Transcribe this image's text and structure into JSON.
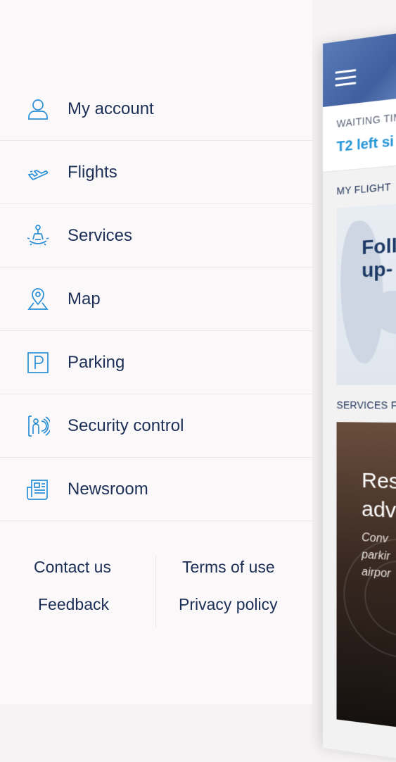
{
  "background": {
    "waiting_caption": "WAITING TIM",
    "waiting_value": "T2 left si",
    "my_flights_caption": "MY FLIGHT",
    "flights_card_text": [
      "Foll",
      "up-"
    ],
    "services_caption": "SERVICES F",
    "services_card_heading": [
      "Res",
      "adv"
    ],
    "services_card_text": [
      "Conv",
      "parkir",
      "airpor"
    ]
  },
  "menu": {
    "items": [
      {
        "label": "My account",
        "icon": "user-icon"
      },
      {
        "label": "Flights",
        "icon": "plane-icon"
      },
      {
        "label": "Services",
        "icon": "services-icon"
      },
      {
        "label": "Map",
        "icon": "map-pin-icon"
      },
      {
        "label": "Parking",
        "icon": "parking-icon"
      },
      {
        "label": "Security control",
        "icon": "security-icon"
      },
      {
        "label": "Newsroom",
        "icon": "newspaper-icon"
      }
    ]
  },
  "footer": {
    "contact": "Contact us",
    "terms": "Terms of use",
    "feedback": "Feedback",
    "privacy": "Privacy policy"
  },
  "colors": {
    "accent": "#2b8fd6",
    "text": "#1d2f57",
    "drawer_bg": "#faf8f8"
  }
}
